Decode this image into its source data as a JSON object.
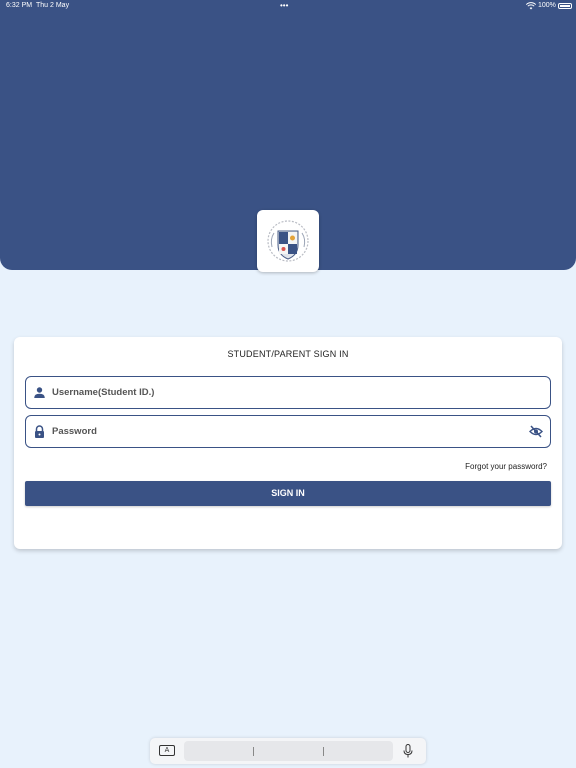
{
  "status_bar": {
    "time": "6:32 PM",
    "date": "Thu 2 May",
    "dots": "•••",
    "battery_percent": "100%"
  },
  "colors": {
    "brand": "#3a5285",
    "background": "#e8f2fc",
    "card": "#ffffff"
  },
  "logo": {
    "icon": "school-crest-logo"
  },
  "login": {
    "title": "STUDENT/PARENT SIGN IN",
    "username_placeholder": "Username(Student ID.)",
    "username_icon": "person-icon",
    "password_placeholder": "Password",
    "password_icon": "lock-icon",
    "visibility_icon": "eye-off-icon",
    "forgot_label": "Forgot your password?",
    "sign_in_label": "SIGN IN"
  },
  "keyboard_bar": {
    "key_label": "A",
    "mic_icon": "microphone-icon"
  }
}
